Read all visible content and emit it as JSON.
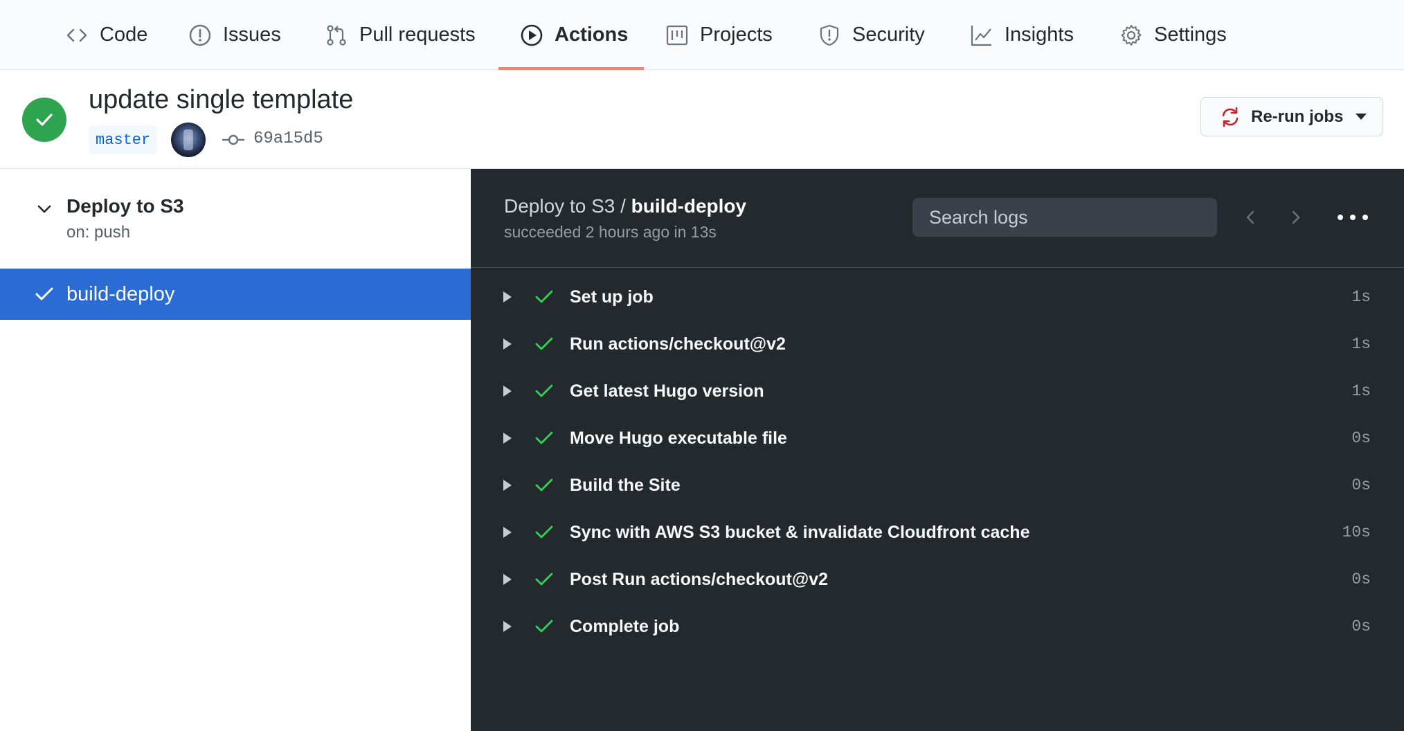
{
  "nav": {
    "tabs": [
      {
        "label": "Code",
        "icon": "code-icon"
      },
      {
        "label": "Issues",
        "icon": "issue-icon"
      },
      {
        "label": "Pull requests",
        "icon": "pull-request-icon"
      },
      {
        "label": "Actions",
        "icon": "play-icon",
        "active": true
      },
      {
        "label": "Projects",
        "icon": "project-icon"
      },
      {
        "label": "Security",
        "icon": "shield-icon"
      },
      {
        "label": "Insights",
        "icon": "graph-icon"
      },
      {
        "label": "Settings",
        "icon": "gear-icon"
      }
    ]
  },
  "run": {
    "title": "update single template",
    "branch": "master",
    "commit": "69a15d5",
    "status": "success",
    "rerun_label": "Re-run jobs"
  },
  "sidebar": {
    "workflow_name": "Deploy to S3",
    "trigger": "on: push",
    "job": "build-deploy"
  },
  "log": {
    "breadcrumb_workflow": "Deploy to S3",
    "breadcrumb_sep": " / ",
    "breadcrumb_job": "build-deploy",
    "summary": "succeeded 2 hours ago in 13s",
    "search_placeholder": "Search logs",
    "steps": [
      {
        "name": "Set up job",
        "duration": "1s"
      },
      {
        "name": "Run actions/checkout@v2",
        "duration": "1s"
      },
      {
        "name": "Get latest Hugo version",
        "duration": "1s"
      },
      {
        "name": "Move Hugo executable file",
        "duration": "0s"
      },
      {
        "name": "Build the Site",
        "duration": "0s"
      },
      {
        "name": "Sync with AWS S3 bucket & invalidate Cloudfront cache",
        "duration": "10s"
      },
      {
        "name": "Post Run actions/checkout@v2",
        "duration": "0s"
      },
      {
        "name": "Complete job",
        "duration": "0s"
      }
    ]
  },
  "colors": {
    "success": "#2ea44f",
    "active_tab_underline": "#f9826c",
    "selected_job_bg": "#2a6bd4",
    "log_bg": "#24292e",
    "rerun_icon": "#cb2431"
  }
}
